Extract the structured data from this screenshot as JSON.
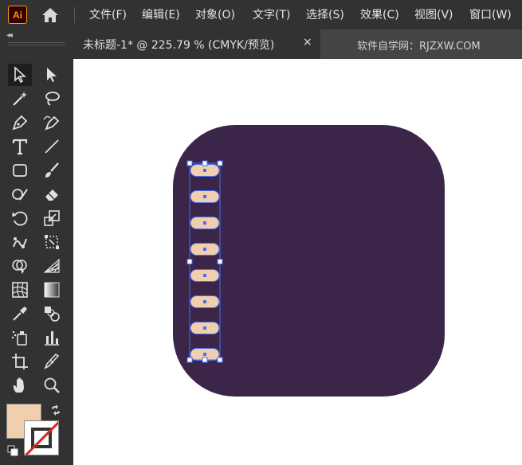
{
  "app": {
    "logo_text": "Ai"
  },
  "menu": {
    "items": [
      "文件(F)",
      "编辑(E)",
      "对象(O)",
      "文字(T)",
      "选择(S)",
      "效果(C)",
      "视图(V)",
      "窗口(W)"
    ]
  },
  "document_tab": {
    "title": "未标题-1* @ 225.79 % (CMYK/预览)",
    "close_glyph": "×"
  },
  "watermark_tab": {
    "text": "软件自学网：RJZXW.COM"
  },
  "colors": {
    "fill": "#f0cfae",
    "artboard_shape": "#3b2649",
    "pill": "#f0cfae",
    "selection": "#4a6cf7"
  },
  "tools": [
    "selection-tool",
    "direct-selection-tool",
    "magic-wand-tool",
    "lasso-tool",
    "pen-tool",
    "curvature-tool",
    "type-tool",
    "line-segment-tool",
    "rectangle-tool",
    "paintbrush-tool",
    "shaper-tool",
    "eraser-tool",
    "rotate-tool",
    "scale-tool",
    "puppet-warp-tool",
    "free-transform-tool",
    "shape-builder-tool",
    "perspective-grid-tool",
    "mesh-tool",
    "gradient-tool",
    "eyedropper-tool",
    "blend-tool",
    "symbol-sprayer-tool",
    "column-graph-tool",
    "artboard-tool",
    "slice-tool",
    "hand-tool",
    "zoom-tool"
  ],
  "artwork": {
    "pill_count": 8
  }
}
